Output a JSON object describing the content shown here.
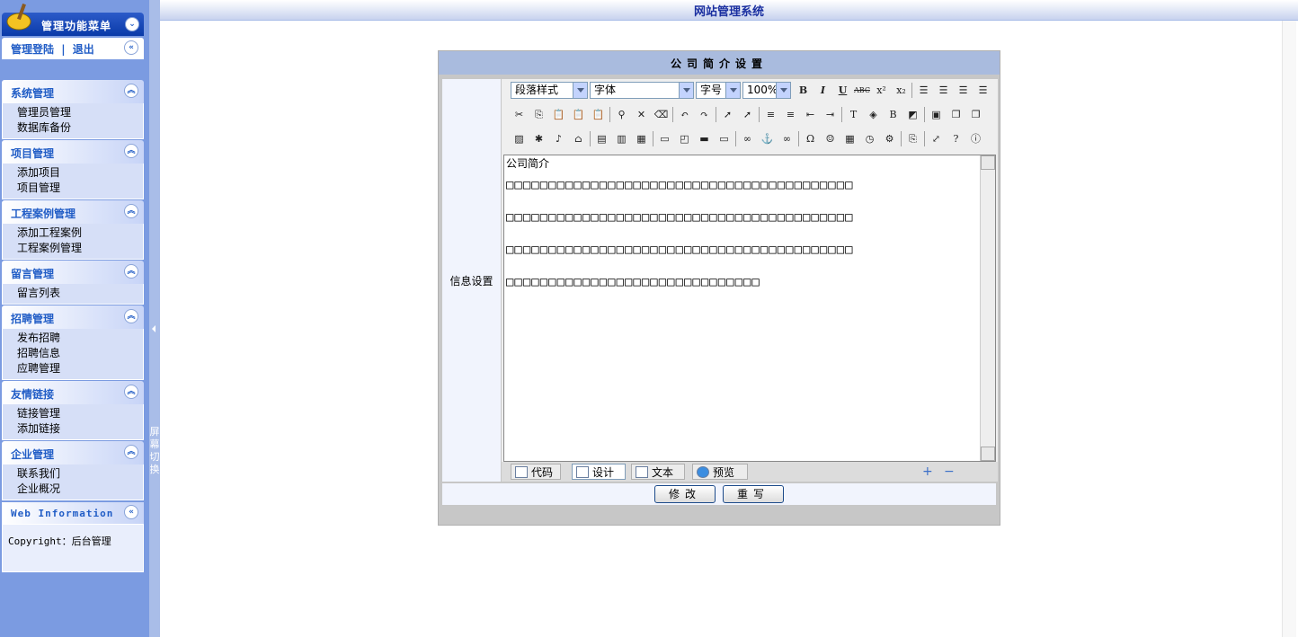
{
  "window": {
    "title": "网站管理系统"
  },
  "sidebar": {
    "menu_title": "管理功能菜单",
    "login_link": "管理登陆",
    "separator": "|",
    "logout_link": "退出",
    "switch_label": "屏幕切换",
    "sections": [
      {
        "title": "系统管理",
        "items": [
          "管理员管理",
          "数据库备份"
        ]
      },
      {
        "title": "项目管理",
        "items": [
          "添加项目",
          "项目管理"
        ]
      },
      {
        "title": "工程案例管理",
        "items": [
          "添加工程案例",
          "工程案例管理"
        ]
      },
      {
        "title": "留言管理",
        "items": [
          "留言列表"
        ]
      },
      {
        "title": "招聘管理",
        "items": [
          "发布招聘",
          "招聘信息",
          "应聘管理"
        ]
      },
      {
        "title": "友情链接",
        "items": [
          "链接管理",
          "添加链接"
        ]
      },
      {
        "title": "企业管理",
        "items": [
          "联系我们",
          "企业概况"
        ]
      }
    ],
    "info": {
      "title": "Web Information",
      "copyright": "Copyright：后台管理"
    }
  },
  "form": {
    "title": "公司简介设置",
    "field_label": "信息设置",
    "toolbar": {
      "paragraph_style": "段落样式",
      "font": "字体",
      "font_size": "字号",
      "zoom": "100%",
      "bold": "B",
      "italic": "I",
      "underline": "U",
      "strike": "ABC",
      "sup": "x²",
      "sub": "x₂"
    },
    "content": {
      "heading": "公司简介",
      "paragraphs": [
        "□□□□□□□□□□□□□□□□□□□□□□□□□□□□□□□□□□□□□□□□□",
        "□□□□□□□□□□□□□□□□□□□□□□□□□□□□□□□□□□□□□□□□□",
        "□□□□□□□□□□□□□□□□□□□□□□□□□□□□□□□□□□□□□□□□□",
        "□□□□□□□□□□□□□□□□□□□□□□□□□□□□□□"
      ]
    },
    "modes": [
      "代码",
      "设计",
      "文本",
      "预览"
    ],
    "submit_label": "修改",
    "reset_label": "重写"
  }
}
